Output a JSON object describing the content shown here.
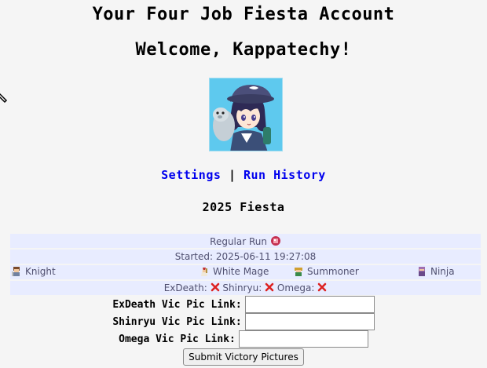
{
  "header": {
    "title": "Your Four Job Fiesta Account",
    "welcome": "Welcome, Kappatechy!"
  },
  "nav": {
    "settings_label": "Settings",
    "separator": "|",
    "run_history_label": "Run History"
  },
  "fiesta": {
    "year_label": "2025 Fiesta"
  },
  "run": {
    "type_label": "Regular Run",
    "started_label": "Started: 2025-06-11 19:27:08",
    "jobs": [
      {
        "name": "Knight",
        "icon": "knight-sprite-icon"
      },
      {
        "name": "White Mage",
        "icon": "white-mage-sprite-icon"
      },
      {
        "name": "Summoner",
        "icon": "summoner-sprite-icon"
      },
      {
        "name": "Ninja",
        "icon": "ninja-sprite-icon"
      }
    ],
    "bosses": [
      {
        "name": "ExDeath:",
        "status_icon": "red-x-icon"
      },
      {
        "name": "Shinryu:",
        "status_icon": "red-x-icon"
      },
      {
        "name": "Omega:",
        "status_icon": "red-x-icon"
      }
    ]
  },
  "victory_form": {
    "exdeath_label": "ExDeath Vic Pic Link:",
    "exdeath_value": "",
    "shinryu_label": "Shinryu Vic Pic Link:",
    "shinryu_value": "",
    "omega_label": "Omega Vic Pic Link:",
    "omega_value": "",
    "submit_label": "Submit Victory Pictures"
  },
  "colors": {
    "page_background": "#f5f5f5",
    "row_background": "#e8ecff",
    "link_color": "#0000ee",
    "row_text": "#505070",
    "status_fail": "#dd2222"
  }
}
